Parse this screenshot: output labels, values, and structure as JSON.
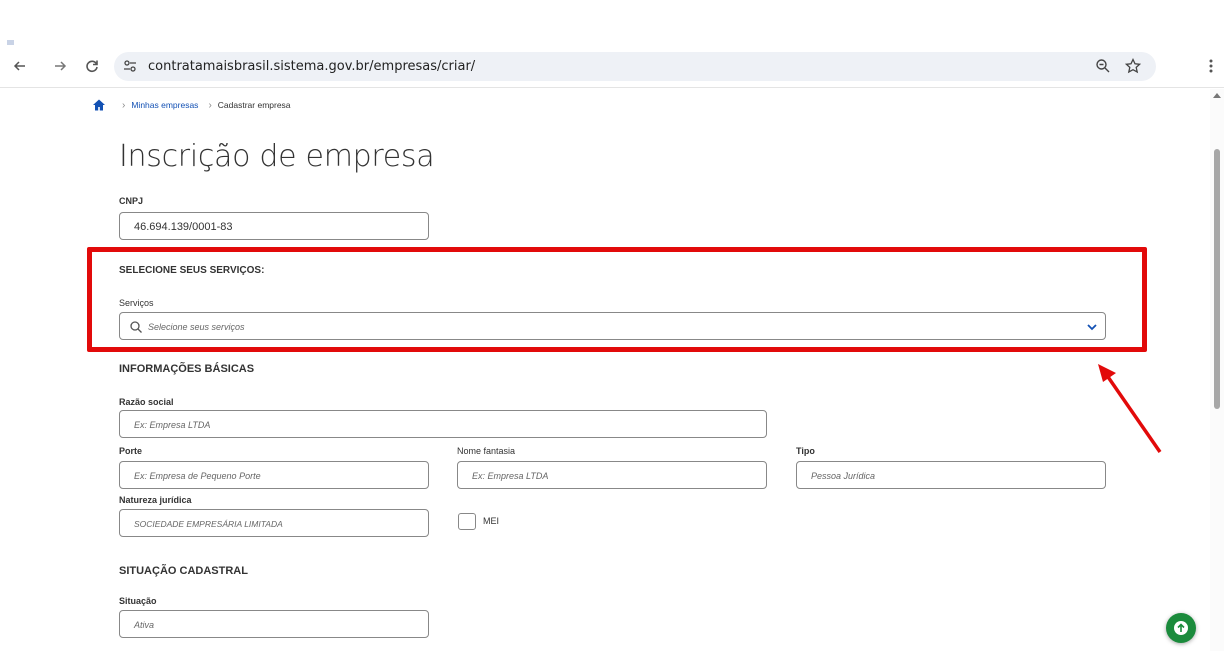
{
  "browser": {
    "url": "contratamaisbrasil.sistema.gov.br/empresas/criar/",
    "icons": [
      "back-icon",
      "forward-icon",
      "reload-icon",
      "site-info-icon",
      "zoom-icon",
      "star-icon",
      "menu-icon"
    ]
  },
  "breadcrumb": {
    "items": [
      "Minhas empresas",
      "Cadastrar empresa"
    ]
  },
  "page": {
    "title": "Inscrição de empresa"
  },
  "cnpj": {
    "label": "CNPJ",
    "value": "46.694.139/0001-83"
  },
  "services": {
    "section_title": "SELECIONE SEUS SERVIÇOS:",
    "label": "Serviços",
    "placeholder": "Selecione seus serviços"
  },
  "basic_info": {
    "section_title": "INFORMAÇÕES BÁSICAS",
    "razao_social": {
      "label": "Razão social",
      "placeholder": "Ex: Empresa LTDA"
    },
    "porte": {
      "label": "Porte",
      "placeholder": "Ex: Empresa de Pequeno Porte"
    },
    "nome_fantasia": {
      "label": "Nome fantasia",
      "placeholder": "Ex: Empresa LTDA"
    },
    "tipo": {
      "label": "Tipo",
      "placeholder": "Pessoa Jurídica"
    },
    "natureza": {
      "label": "Natureza jurídica",
      "placeholder": "SOCIEDADE EMPRESÁRIA LIMITADA"
    },
    "mei": {
      "label": "MEI",
      "checked": false
    }
  },
  "registration": {
    "section_title": "SITUAÇÃO CADASTRAL",
    "situacao": {
      "label": "Situação",
      "placeholder": "Ativa"
    }
  },
  "colors": {
    "accent": "#1351b4",
    "highlight": "#e20a0a",
    "fab": "#1b8b3c"
  }
}
